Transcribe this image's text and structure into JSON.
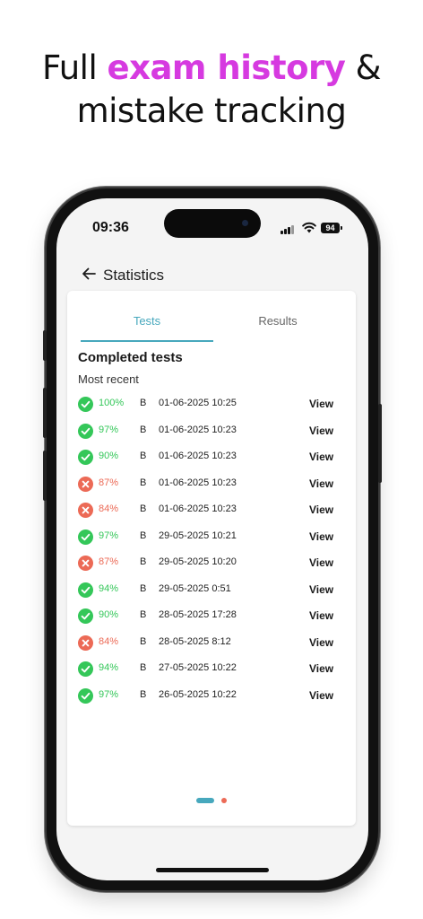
{
  "headline": {
    "line1_prefix": "Full ",
    "line1_highlight": "exam history",
    "line1_suffix": " &",
    "line2": "mistake tracking",
    "highlight_color": "#d63ae0"
  },
  "status_bar": {
    "time": "09:36",
    "battery": "94"
  },
  "app_bar": {
    "title": "Statistics",
    "back_icon": "arrow-left-icon"
  },
  "tabs": [
    {
      "label": "Tests",
      "active": true
    },
    {
      "label": "Results",
      "active": false
    }
  ],
  "section": {
    "title": "Completed tests",
    "subtitle": "Most recent"
  },
  "colors": {
    "accent": "#47a8bd",
    "pass": "#34c759",
    "fail": "#ec6a56"
  },
  "tests": [
    {
      "status": "pass",
      "score": "100%",
      "category": "B",
      "datetime": "01-06-2025 10:25",
      "action": "View"
    },
    {
      "status": "pass",
      "score": "97%",
      "category": "B",
      "datetime": "01-06-2025 10:23",
      "action": "View"
    },
    {
      "status": "pass",
      "score": "90%",
      "category": "B",
      "datetime": "01-06-2025 10:23",
      "action": "View"
    },
    {
      "status": "fail",
      "score": "87%",
      "category": "B",
      "datetime": "01-06-2025 10:23",
      "action": "View"
    },
    {
      "status": "fail",
      "score": "84%",
      "category": "B",
      "datetime": "01-06-2025 10:23",
      "action": "View"
    },
    {
      "status": "pass",
      "score": "97%",
      "category": "B",
      "datetime": "29-05-2025 10:21",
      "action": "View"
    },
    {
      "status": "fail",
      "score": "87%",
      "category": "B",
      "datetime": "29-05-2025 10:20",
      "action": "View"
    },
    {
      "status": "pass",
      "score": "94%",
      "category": "B",
      "datetime": "29-05-2025 0:51",
      "action": "View"
    },
    {
      "status": "pass",
      "score": "90%",
      "category": "B",
      "datetime": "28-05-2025 17:28",
      "action": "View"
    },
    {
      "status": "fail",
      "score": "84%",
      "category": "B",
      "datetime": "28-05-2025 8:12",
      "action": "View"
    },
    {
      "status": "pass",
      "score": "94%",
      "category": "B",
      "datetime": "27-05-2025 10:22",
      "action": "View"
    },
    {
      "status": "pass",
      "score": "97%",
      "category": "B",
      "datetime": "26-05-2025 10:22",
      "action": "View"
    }
  ],
  "pager": {
    "count": 2,
    "active_index": 0
  }
}
